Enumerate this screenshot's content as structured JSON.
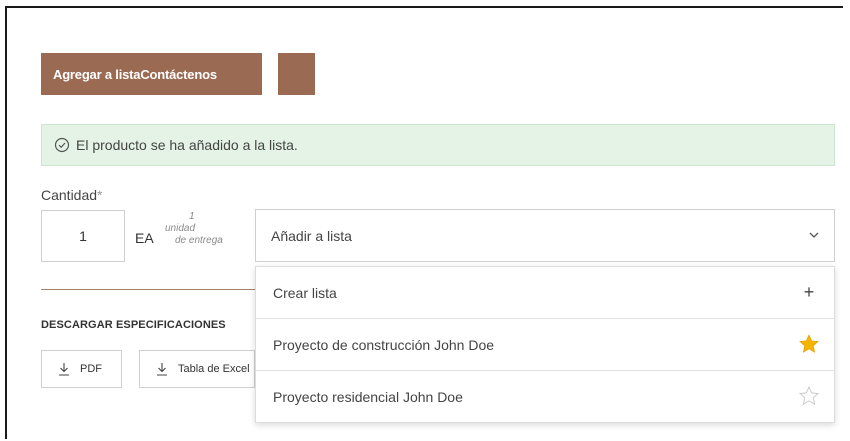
{
  "actions": {
    "add_button_label": "Agregar a listaContáctenos"
  },
  "alert": {
    "message": "El producto se ha añadido a la lista."
  },
  "quantity": {
    "label": "Cantidad",
    "required_mark": "*",
    "value": "1",
    "unit": "EA",
    "unit_note": [
      "1",
      "unidad",
      "de entrega"
    ]
  },
  "list_select": {
    "selected": "Añadir a lista"
  },
  "dropdown": {
    "items": [
      {
        "label": "Crear lista",
        "icon": "plus-icon"
      },
      {
        "label": "Proyecto de construcción John Doe",
        "icon": "star-filled-icon"
      },
      {
        "label": "Proyecto residencial John Doe",
        "icon": "star-outline-icon"
      }
    ]
  },
  "downloads": {
    "heading": "DESCARGAR ESPECIFICACIONES",
    "pdf_label": "PDF",
    "excel_label": "Tabla de Excel"
  },
  "colors": {
    "brand_brown": "#9a6a52",
    "alert_bg": "#e4f3e6",
    "star": "#f5b400"
  }
}
